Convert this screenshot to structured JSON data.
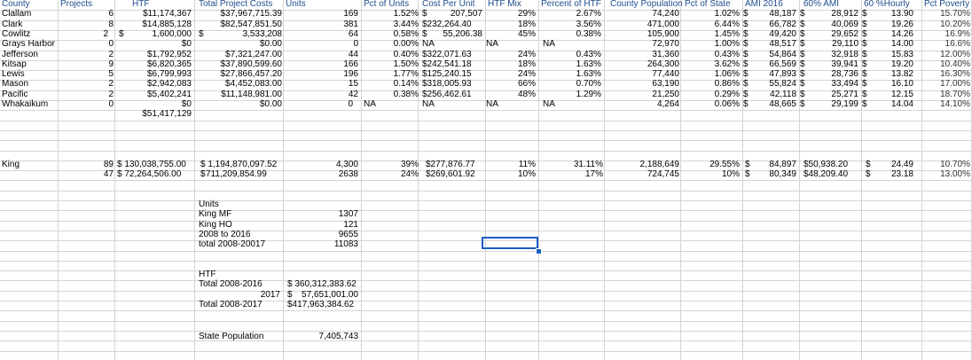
{
  "header": [
    "County",
    "Projects",
    "HTF",
    "Total Project Costs",
    "Units",
    "Pct of Units",
    "Cost Per Unit",
    "HTF Mix",
    "Percent of HTF",
    "County Population",
    "Pct of State",
    "AMI 2016",
    "60% AMI",
    "60 %Hourly",
    "Pct Poverty"
  ],
  "rows": [
    {
      "cells": [
        "Clallam",
        "6",
        "$11,174,367",
        "$37,967,715.39",
        "169",
        "1.52%",
        "$",
        "207,507",
        "29%",
        "2.67%",
        "74,240",
        "1.02%",
        "$",
        "48,187",
        "$",
        "28,912",
        "$",
        "13.90",
        "15.70%"
      ]
    },
    {
      "cells": [
        "Clark",
        "8",
        "$14,885,128",
        "$82,547,851.50",
        "381",
        "3.44%",
        "$232,264.40",
        "",
        "18%",
        "3.56%",
        "471,000",
        "6.44%",
        "$",
        "66,782",
        "$",
        "40,069",
        "$",
        "19.26",
        "10.20%"
      ]
    },
    {
      "cells": [
        "Cowlitz",
        "2",
        "$",
        "1,600,000",
        "$",
        "3,533,208",
        "64",
        "0.58%",
        "$",
        "55,206.38",
        "45%",
        "0.38%",
        "105,900",
        "1.45%",
        "$",
        "49,420",
        "$",
        "29,652",
        "$",
        "14.26",
        "16.9%"
      ]
    },
    {
      "cells": [
        "Grays Harbor",
        "0",
        "$0",
        "$0.00",
        "0",
        "0.00%",
        "NA",
        "NA",
        "NA",
        "72,970",
        "1.00%",
        "$",
        "48,517",
        "$",
        "29,110",
        "$",
        "14.00",
        "16.6%"
      ]
    },
    {
      "cells": [
        "Jefferson",
        "2",
        "$1,792,952",
        "$7,321,247.00",
        "44",
        "0.40%",
        "$322,071.63",
        "24%",
        "0.43%",
        "31,360",
        "0.43%",
        "$",
        "54,864",
        "$",
        "32,918",
        "$",
        "15.83",
        "12.00%"
      ]
    },
    {
      "cells": [
        "Kitsap",
        "9",
        "$6,820,365",
        "$37,890,599.60",
        "166",
        "1.50%",
        "$242,541.18",
        "18%",
        "1.63%",
        "264,300",
        "3.62%",
        "$",
        "66,569",
        "$",
        "39,941",
        "$",
        "19.20",
        "10.40%"
      ]
    },
    {
      "cells": [
        "Lewis",
        "5",
        "$6,799,993",
        "$27,866,457.20",
        "196",
        "1.77%",
        "$125,240.15",
        "24%",
        "1.63%",
        "77,440",
        "1.06%",
        "$",
        "47,893",
        "$",
        "28,736",
        "$",
        "13.82",
        "16.30%"
      ]
    },
    {
      "cells": [
        "Mason",
        "2",
        "$2,942,083",
        "$4,452,083.00",
        "15",
        "0.14%",
        "$318,005.93",
        "66%",
        "0.70%",
        "63,190",
        "0.86%",
        "$",
        "55,824",
        "$",
        "33,494",
        "$",
        "16.10",
        "17.00%"
      ]
    },
    {
      "cells": [
        "Pacific",
        "2",
        "$5,402,241",
        "$11,148,981.00",
        "42",
        "0.38%",
        "$256,462.61",
        "48%",
        "1.29%",
        "21,250",
        "0.29%",
        "$",
        "42,118",
        "$",
        "25,271",
        "$",
        "12.15",
        "18.70%"
      ]
    },
    {
      "cells": [
        "Whakaikum",
        "0",
        "$0",
        "$0.00",
        "0",
        "NA",
        "NA",
        "NA",
        "NA",
        "4,264",
        "0.06%",
        "$",
        "48,665",
        "$",
        "29,199",
        "$",
        "14.04",
        "14.10%"
      ]
    },
    {
      "cells": [
        "$51,417,129"
      ]
    }
  ],
  "king": {
    "row1": [
      "King",
      "89",
      "$ 130,038,755.00",
      "$ 1,194,870,097.52",
      "4,300",
      "39%",
      "$277,876.77",
      "11%",
      "31.11%",
      "2,188,649",
      "29.55%",
      "$",
      "84,897",
      "$50,938.20",
      "$",
      "24.49",
      "10.70%"
    ],
    "row2": [
      "47",
      "$ 72,264,506.00",
      "$",
      "711,209,854.99",
      "2638",
      "24%",
      "$269,601.92",
      "10%",
      "17%",
      "724,745",
      "10%",
      "$",
      "80,349",
      "$48,209.40",
      "$",
      "23.18",
      "13.00%"
    ]
  },
  "units_block": {
    "title": "Units",
    "items": [
      {
        "label": "King MF",
        "value": "1307"
      },
      {
        "label": "King HO",
        "value": "121"
      },
      {
        "label": "2008 to 2016",
        "value": "9655"
      },
      {
        "label": "total 2008-20017",
        "value": "11083"
      }
    ]
  },
  "htf_block": {
    "title": "HTF",
    "total_2016_label": "Total 2008-2016",
    "total_2016_value": "$ 360,312,383.62",
    "year_2017_label": "2017",
    "year_2017_dollar": "$",
    "year_2017_value": "57,651,001.00",
    "total_2017_label": "Total 2008-2017",
    "total_2017_value": "$417,963,384.62"
  },
  "state_population": {
    "label": "State Population",
    "value": "7,405,743"
  },
  "colors": {
    "header_text": "#1f4e8c",
    "gridline": "#d4d4d4",
    "selection": "#1d5fbf"
  }
}
